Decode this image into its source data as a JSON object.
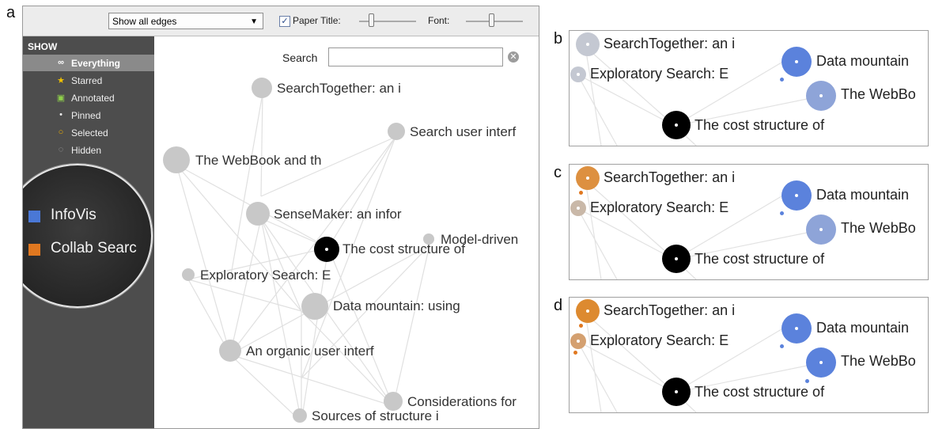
{
  "panel_letters": {
    "a": "a",
    "b": "b",
    "c": "c",
    "d": "d"
  },
  "toolbar": {
    "edge_select": "Show all edges",
    "paper_title_checked": true,
    "paper_title_label": "Paper Title:",
    "font_label": "Font:",
    "checkmark": "✓",
    "dropdown_icon": "chevron-down-icon"
  },
  "sidebar": {
    "title": "SHOW",
    "items": [
      {
        "icon": "infinity-icon",
        "glyph": "∞",
        "label": "Everything",
        "active": true
      },
      {
        "icon": "star-icon",
        "glyph": "★",
        "label": "Starred",
        "active": false
      },
      {
        "icon": "annotation-icon",
        "glyph": "▣",
        "label": "Annotated",
        "active": false
      },
      {
        "icon": "pin-icon",
        "glyph": "•",
        "label": "Pinned",
        "active": false
      },
      {
        "icon": "selected-ring-icon",
        "glyph": "○",
        "label": "Selected",
        "active": false
      },
      {
        "icon": "hidden-ring-icon",
        "glyph": "◌",
        "label": "Hidden",
        "active": false
      }
    ],
    "magnified_legend": [
      {
        "label": "InfoVis",
        "color": "#4a78d6"
      },
      {
        "label": "Collab Searc",
        "color": "#e07820"
      }
    ]
  },
  "search": {
    "label": "Search",
    "value": "",
    "clear_icon": "clear-icon"
  },
  "graph_nodes": [
    {
      "label": "SearchTogether: an i",
      "color": "#c8c8c8"
    },
    {
      "label": "Search user interf",
      "color": "#c8c8c8"
    },
    {
      "label": "The WebBook and th",
      "color": "#c8c8c8"
    },
    {
      "label": "SenseMaker: an infor",
      "color": "#c8c8c8"
    },
    {
      "label": "Model-driven",
      "color": "#c8c8c8"
    },
    {
      "label": "The cost structure of",
      "color": "#000000"
    },
    {
      "label": "Exploratory Search: E",
      "color": "#c8c8c8"
    },
    {
      "label": "Data mountain: using",
      "color": "#c8c8c8"
    },
    {
      "label": "An organic user interf",
      "color": "#c8c8c8"
    },
    {
      "label": "Considerations for",
      "color": "#c8c8c8"
    },
    {
      "label": "Sources of structure i",
      "color": "#c8c8c8"
    }
  ],
  "subpanels": [
    {
      "id": "b",
      "nodes": [
        {
          "label": "SearchTogether: an i",
          "color": "#c4c8d2"
        },
        {
          "label": "Exploratory Search: E",
          "color": "#c4c8d2"
        },
        {
          "label": "Data mountain",
          "color": "#5b82dc"
        },
        {
          "label": "The WebBo",
          "color": "#8ea4d8"
        },
        {
          "label": "The cost structure of",
          "color": "#000000"
        }
      ]
    },
    {
      "id": "c",
      "nodes": [
        {
          "label": "SearchTogether: an i",
          "color": "#dd9040"
        },
        {
          "label": "Exploratory Search: E",
          "color": "#c9b8a8"
        },
        {
          "label": "Data mountain",
          "color": "#5b82dc"
        },
        {
          "label": "The WebBo",
          "color": "#8ea4d8"
        },
        {
          "label": "The cost structure of",
          "color": "#000000"
        }
      ]
    },
    {
      "id": "d",
      "nodes": [
        {
          "label": "SearchTogether: an i",
          "color": "#dd8a30"
        },
        {
          "label": "Exploratory Search: E",
          "color": "#d4a070"
        },
        {
          "label": "Data mountain",
          "color": "#5b82dc"
        },
        {
          "label": "The WebBo",
          "color": "#5b82dc"
        },
        {
          "label": "The cost structure of",
          "color": "#000000"
        }
      ]
    }
  ]
}
